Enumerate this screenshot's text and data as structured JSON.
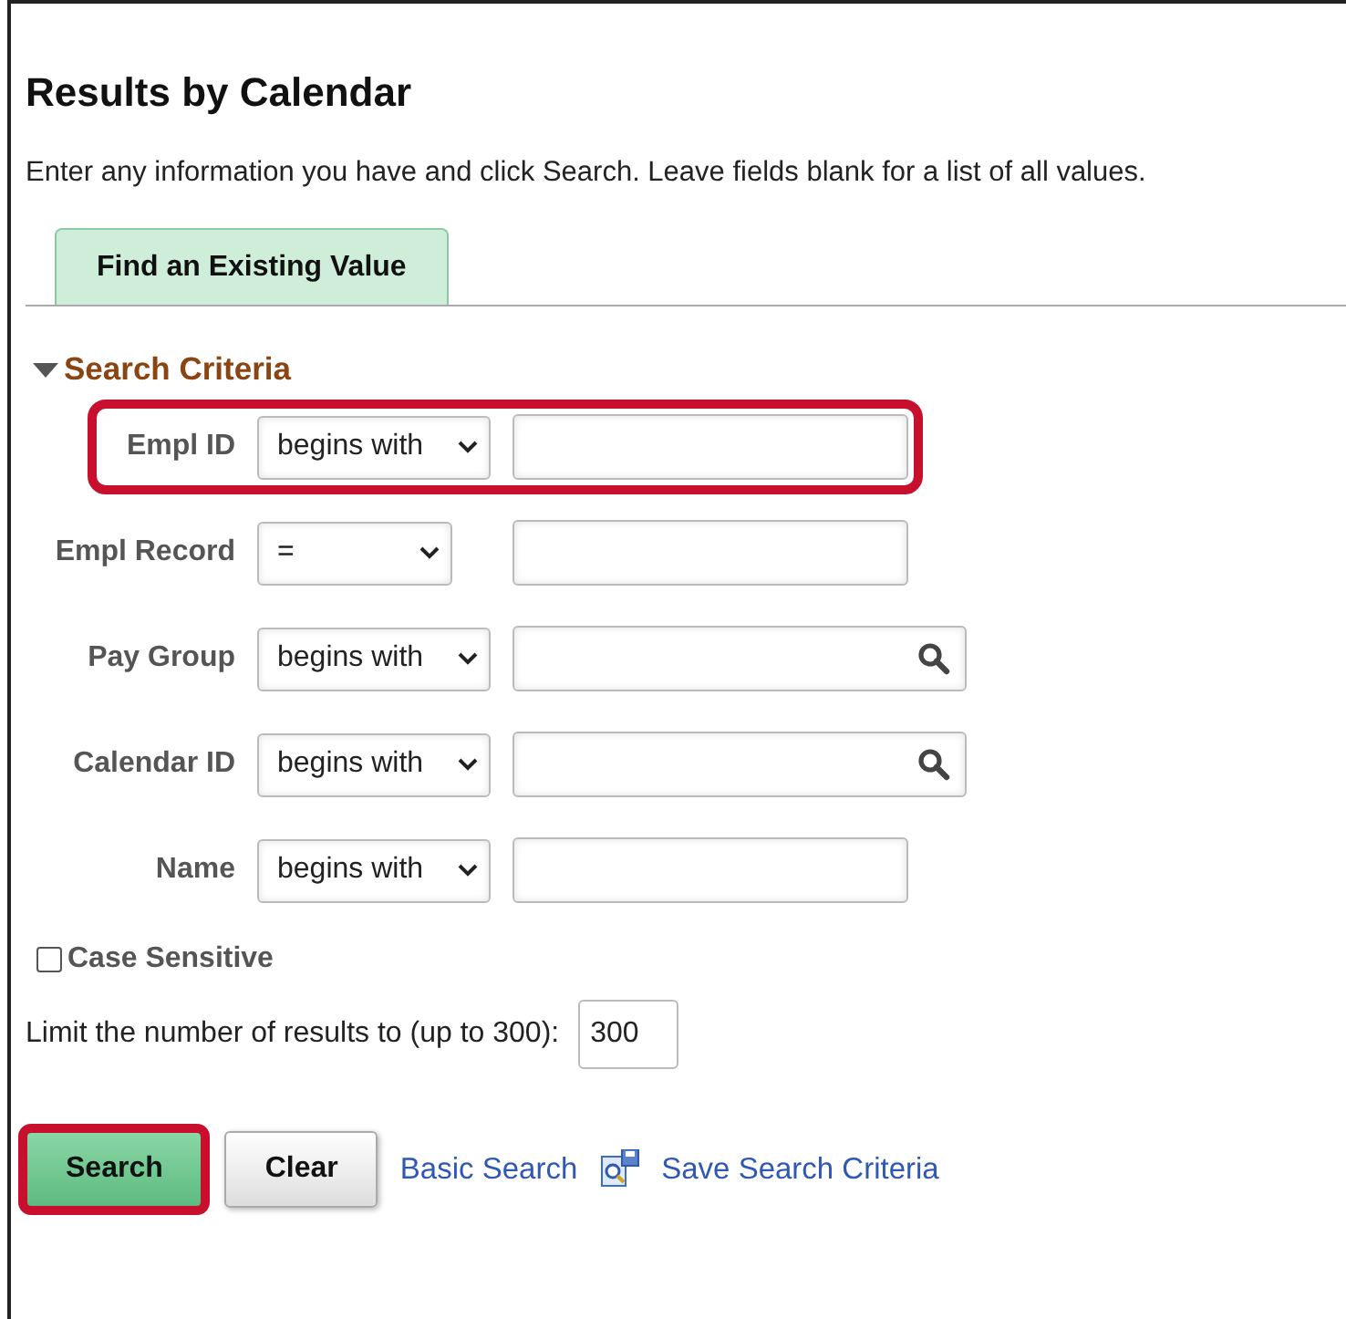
{
  "title": "Results by Calendar",
  "instructions": "Enter any information you have and click Search. Leave fields blank for a list of all values.",
  "tabs": [
    {
      "label": "Find an Existing Value",
      "selected": true
    }
  ],
  "section": {
    "label": "Search Criteria",
    "expanded": true
  },
  "fields": [
    {
      "label": "Empl ID",
      "operator": "begins with",
      "wide_operator": true,
      "lookup": false,
      "highlighted": true
    },
    {
      "label": "Empl Record",
      "operator": "=",
      "wide_operator": false,
      "lookup": false,
      "highlighted": false
    },
    {
      "label": "Pay Group",
      "operator": "begins with",
      "wide_operator": true,
      "lookup": true,
      "highlighted": false
    },
    {
      "label": "Calendar ID",
      "operator": "begins with",
      "wide_operator": true,
      "lookup": true,
      "highlighted": false
    },
    {
      "label": "Name",
      "operator": "begins with",
      "wide_operator": true,
      "lookup": false,
      "highlighted": false
    }
  ],
  "case_sensitive": {
    "label": "Case Sensitive",
    "checked": false
  },
  "limit": {
    "label": "Limit the number of results to (up to 300):",
    "value": "300"
  },
  "buttons": [
    {
      "label": "Search",
      "kind": "primary",
      "highlighted": true
    },
    {
      "label": "Clear",
      "kind": "secondary",
      "highlighted": false
    }
  ],
  "links": [
    {
      "label": "Basic Search",
      "icon": false
    },
    {
      "label": "Save Search Criteria",
      "icon": true
    }
  ]
}
